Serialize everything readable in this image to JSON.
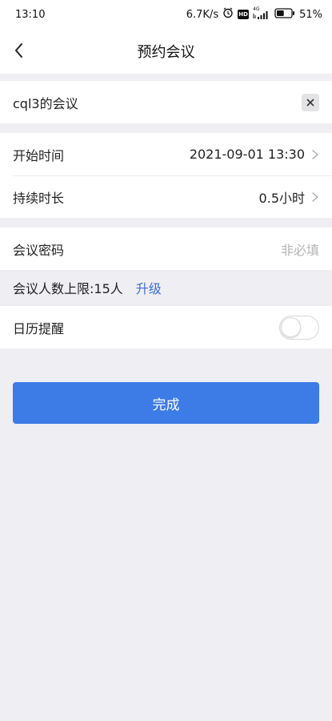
{
  "status_bar": {
    "time": "13:10",
    "speed": "6.7K/s",
    "network_label": "4G",
    "hd_label": "HD",
    "battery_text": "51%",
    "battery_level": 0.51
  },
  "nav": {
    "title": "预约会议",
    "back_icon": "chevron-left-icon"
  },
  "meeting": {
    "name_value": "cql3的会议",
    "clear_icon": "close-icon"
  },
  "schedule": {
    "start_label": "开始时间",
    "start_value": "2021-09-01 13:30",
    "duration_label": "持续时长",
    "duration_value": "0.5小时"
  },
  "password": {
    "label": "会议密码",
    "placeholder": "非必填"
  },
  "limit": {
    "text": "会议人数上限:15人",
    "upgrade_label": "升级"
  },
  "calendar": {
    "label": "日历提醒",
    "enabled": false
  },
  "submit_label": "完成",
  "colors": {
    "primary": "#3d7be6",
    "link": "#3e6dd6",
    "background": "#efeef3"
  }
}
